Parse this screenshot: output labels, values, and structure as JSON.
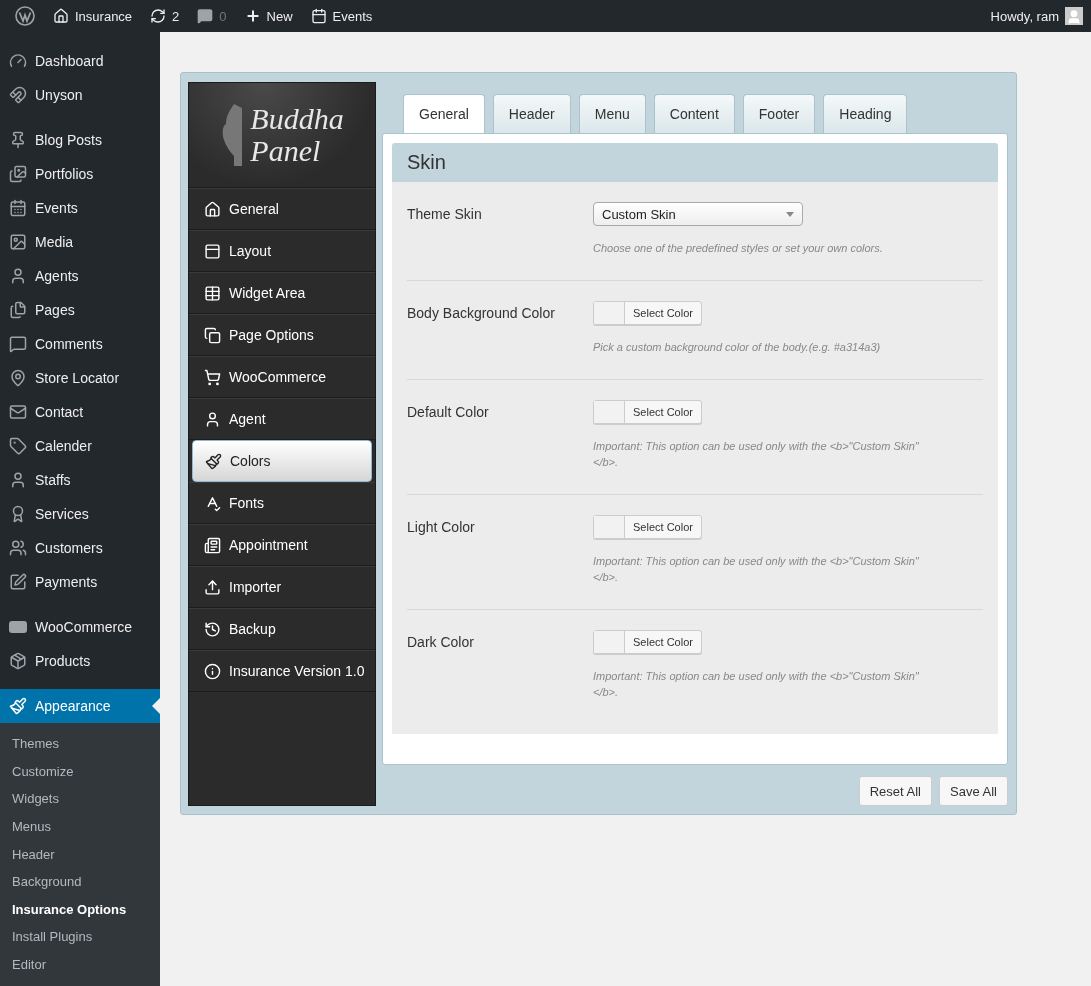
{
  "admin_bar": {
    "items": [
      {
        "kind": "logo"
      },
      {
        "kind": "site",
        "label": "Insurance"
      },
      {
        "kind": "updates",
        "label": "2"
      },
      {
        "kind": "comments",
        "label": "0"
      },
      {
        "kind": "new",
        "label": "New"
      },
      {
        "kind": "events",
        "label": "Events"
      }
    ],
    "greeting": "Howdy, ram"
  },
  "admin_menu": {
    "groups": [
      [
        {
          "label": "Dashboard",
          "selected": false
        },
        {
          "label": "Unyson",
          "selected": false
        }
      ],
      [
        {
          "label": "Blog Posts",
          "selected": false
        },
        {
          "label": "Portfolios",
          "selected": false
        },
        {
          "label": "Events",
          "selected": false
        },
        {
          "label": "Media",
          "selected": false
        },
        {
          "label": "Agents",
          "selected": false
        },
        {
          "label": "Pages",
          "selected": false
        },
        {
          "label": "Comments",
          "selected": false
        },
        {
          "label": "Store Locator",
          "selected": false
        },
        {
          "label": "Contact",
          "selected": false
        },
        {
          "label": "Calender",
          "selected": false
        },
        {
          "label": "Staffs",
          "selected": false
        },
        {
          "label": "Services",
          "selected": false
        },
        {
          "label": "Customers",
          "selected": false
        },
        {
          "label": "Payments",
          "selected": false
        }
      ],
      [
        {
          "label": "WooCommerce",
          "selected": false
        },
        {
          "label": "Products",
          "selected": false
        }
      ],
      [
        {
          "label": "Appearance",
          "selected": true
        }
      ]
    ],
    "submenu": [
      {
        "label": "Themes",
        "selected": false
      },
      {
        "label": "Customize",
        "selected": false
      },
      {
        "label": "Widgets",
        "selected": false
      },
      {
        "label": "Menus",
        "selected": false
      },
      {
        "label": "Header",
        "selected": false
      },
      {
        "label": "Background",
        "selected": false
      },
      {
        "label": "Insurance Options",
        "selected": true
      },
      {
        "label": "Install Plugins",
        "selected": false
      },
      {
        "label": "Editor",
        "selected": false
      }
    ]
  },
  "panel": {
    "logo": [
      "Buddha",
      "Panel"
    ],
    "nav": [
      {
        "label": "General",
        "selected": false
      },
      {
        "label": "Layout",
        "selected": false
      },
      {
        "label": "Widget Area",
        "selected": false
      },
      {
        "label": "Page Options",
        "selected": false
      },
      {
        "label": "WooCommerce",
        "selected": false
      },
      {
        "label": "Agent",
        "selected": false
      },
      {
        "label": "Colors",
        "selected": true
      },
      {
        "label": "Fonts",
        "selected": false
      },
      {
        "label": "Appointment",
        "selected": false
      },
      {
        "label": "Importer",
        "selected": false
      },
      {
        "label": "Backup",
        "selected": false
      },
      {
        "label": "Insurance Version 1.0",
        "selected": false
      }
    ],
    "tabs": [
      {
        "label": "General",
        "selected": true
      },
      {
        "label": "Header",
        "selected": false
      },
      {
        "label": "Menu",
        "selected": false
      },
      {
        "label": "Content",
        "selected": false
      },
      {
        "label": "Footer",
        "selected": false
      },
      {
        "label": "Heading",
        "selected": false
      }
    ],
    "section_title": "Skin",
    "fields": [
      {
        "kind": "select",
        "label": "Theme Skin",
        "value": "Custom Skin",
        "hint": "Choose one of the predefined styles or set your own colors."
      },
      {
        "kind": "color",
        "label": "Body Background Color",
        "button": "Select Color",
        "hint": "Pick a custom background color of the body.(e.g. #a314a3)"
      },
      {
        "kind": "color",
        "label": "Default Color",
        "button": "Select Color",
        "hint": "Important: This option can be used only with the <b>\"Custom Skin\"</b>."
      },
      {
        "kind": "color",
        "label": "Light Color",
        "button": "Select Color",
        "hint": "Important: This option can be used only with the <b>\"Custom Skin\"</b>."
      },
      {
        "kind": "color",
        "label": "Dark Color",
        "button": "Select Color",
        "hint": "Important: This option can be used only with the <b>\"Custom Skin\"</b>."
      }
    ],
    "buttons": [
      "Reset All",
      "Save All"
    ]
  }
}
